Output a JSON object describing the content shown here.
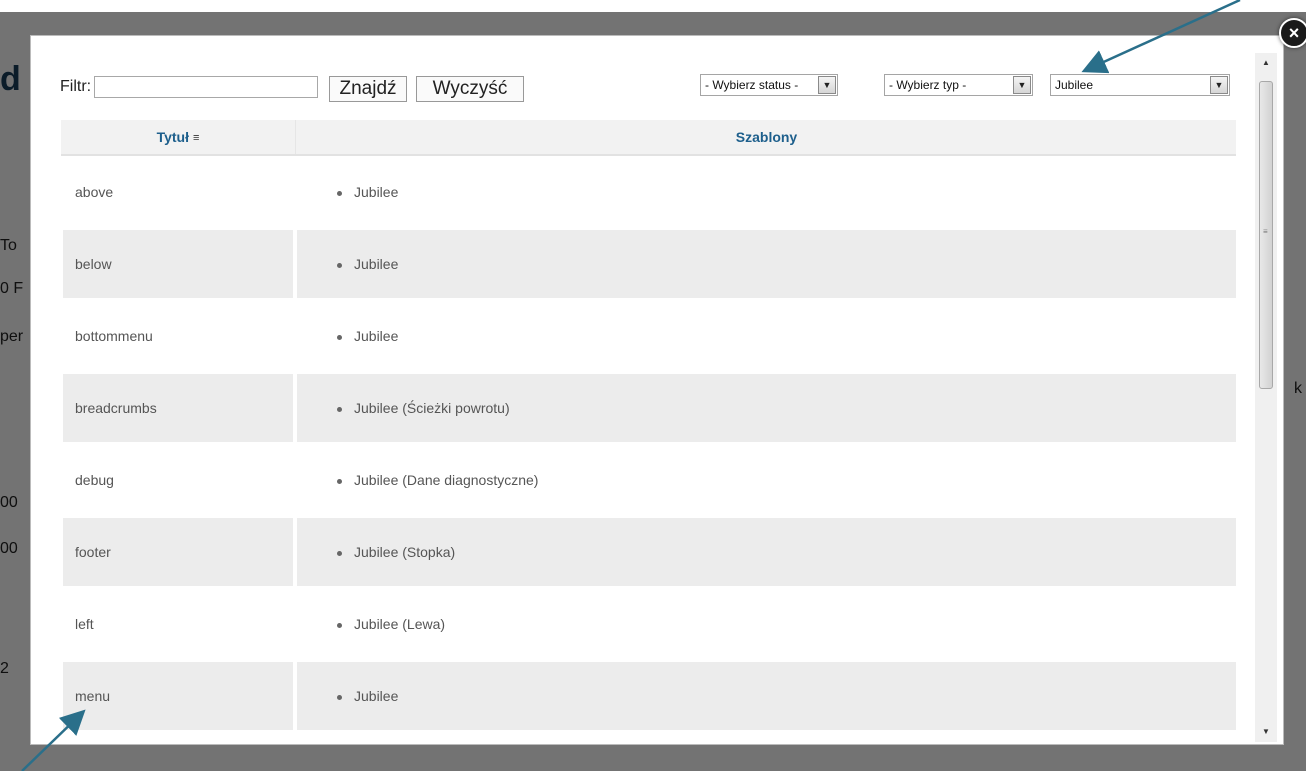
{
  "background_fragments": [
    {
      "text": "d",
      "cls": "big",
      "l": 0,
      "t": 60
    },
    {
      "text": "To",
      "cls": "",
      "l": 0,
      "t": 237
    },
    {
      "text": "0 F",
      "cls": "",
      "l": 0,
      "t": 280
    },
    {
      "text": "per",
      "cls": "",
      "l": 0,
      "t": 328
    },
    {
      "text": "00",
      "cls": "",
      "l": 0,
      "t": 494
    },
    {
      "text": "00",
      "cls": "",
      "l": 0,
      "t": 540
    },
    {
      "text": "2",
      "cls": "",
      "l": 0,
      "t": 660
    },
    {
      "text": "k",
      "cls": "",
      "l": 1294,
      "t": 380
    }
  ],
  "modal": {
    "close_label": "×",
    "filter": {
      "label": "Filtr:",
      "value": "",
      "find_button": "Znajdź",
      "clear_button": "Wyczyść"
    },
    "selects": {
      "status": "- Wybierz status -",
      "type": "- Wybierz typ -",
      "template": "Jubilee"
    },
    "table": {
      "headers": {
        "title": "Tytuł",
        "templates": "Szablony"
      },
      "rows": [
        {
          "title": "above",
          "template": "Jubilee"
        },
        {
          "title": "below",
          "template": "Jubilee"
        },
        {
          "title": "bottommenu",
          "template": "Jubilee"
        },
        {
          "title": "breadcrumbs",
          "template": "Jubilee (Ścieżki powrotu)"
        },
        {
          "title": "debug",
          "template": "Jubilee (Dane diagnostyczne)"
        },
        {
          "title": "footer",
          "template": "Jubilee (Stopka)"
        },
        {
          "title": "left",
          "template": "Jubilee (Lewa)"
        },
        {
          "title": "menu",
          "template": "Jubilee"
        }
      ]
    }
  },
  "colors": {
    "header_text": "#1d5f8c",
    "arrow": "#2a6f8a"
  }
}
